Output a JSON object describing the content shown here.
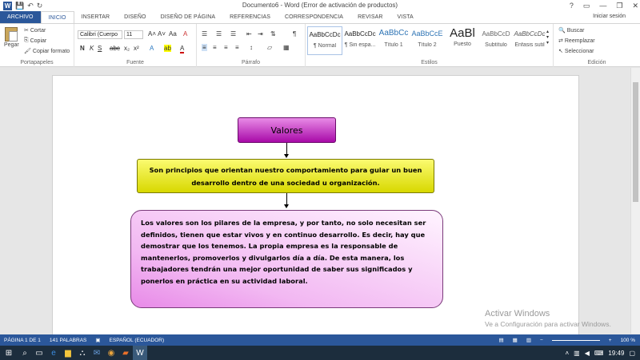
{
  "window": {
    "title": "Documento6 - Word (Error de activación de productos)",
    "controls": [
      "?",
      "▭",
      "—",
      "❐",
      "✕"
    ],
    "signin": "Iniciar sesión"
  },
  "tabs": [
    "ARCHIVO",
    "INICIO",
    "INSERTAR",
    "DISEÑO",
    "DISEÑO DE PÁGINA",
    "REFERENCIAS",
    "CORRESPONDENCIA",
    "REVISAR",
    "VISTA"
  ],
  "ribbon": {
    "clipboard": {
      "paste": "Pegar",
      "cut": "Cortar",
      "copy": "Copiar",
      "format": "Copiar formato",
      "label": "Portapapeles"
    },
    "font": {
      "name": "Calibri (Cuerpo",
      "size": "11",
      "label": "Fuente"
    },
    "paragraph": {
      "label": "Párrafo"
    },
    "styles": {
      "label": "Estilos",
      "items": [
        {
          "preview": "AaBbCcDc",
          "name": "¶ Normal"
        },
        {
          "preview": "AaBbCcDc",
          "name": "¶ Sin espa..."
        },
        {
          "preview": "AaBbCc",
          "name": "Título 1"
        },
        {
          "preview": "AaBbCcE",
          "name": "Título 2"
        },
        {
          "preview": "AaBl",
          "name": "Puesto"
        },
        {
          "preview": "AaBbCcD",
          "name": "Subtítulo"
        },
        {
          "preview": "AaBbCcDc",
          "name": "Énfasis sutil"
        }
      ]
    },
    "editing": {
      "find": "Buscar",
      "replace": "Reemplazar",
      "select": "Seleccionar",
      "label": "Edición"
    }
  },
  "document": {
    "box1": "Valores",
    "box2": "Son principios que orientan nuestro comportamiento para guiar un buen desarrollo dentro de una sociedad u organización.",
    "box3": "Los valores son los pilares de la empresa, y por tanto, no solo necesitan ser definidos, tienen que estar vivos y en continuo desarrollo. Es decir, hay que demostrar que los tenemos. La propia empresa es la responsable de mantenerlos, promoverlos y divulgarlos día a día. De esta manera, los trabajadores tendrán una mejor oportunidad de saber sus significados y ponerlos en práctica en su actividad laboral."
  },
  "watermark": {
    "line1": "Activar Windows",
    "line2": "Ve a Configuración para activar Windows."
  },
  "status": {
    "page": "PÁGINA 1 DE 1",
    "words": "141 PALABRAS",
    "lang": "ESPAÑOL (ECUADOR)",
    "zoom": "100 %"
  },
  "taskbar": {
    "time": "19:49"
  },
  "colors": {
    "accent": "#2b579a",
    "box1": "#c42cc4",
    "box2": "#e8e800",
    "box3": "#f6c8f6"
  }
}
